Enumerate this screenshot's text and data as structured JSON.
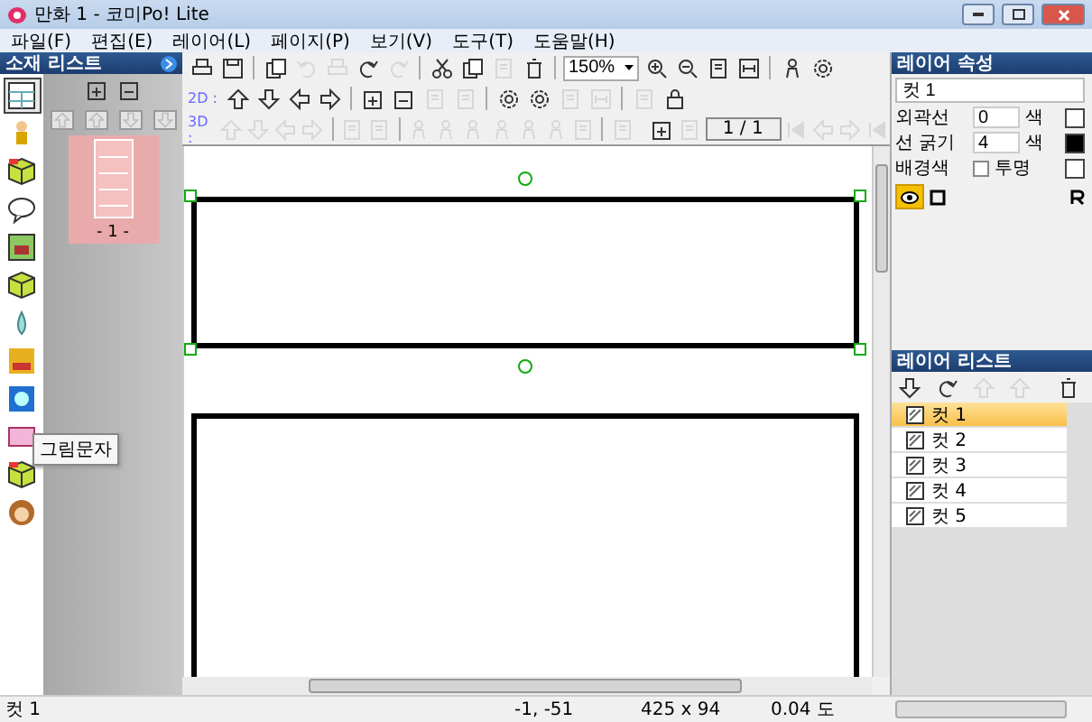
{
  "window": {
    "title": "만화 1 - 코미Po! Lite"
  },
  "menu": [
    "파일(F)",
    "편집(E)",
    "레이어(L)",
    "페이지(P)",
    "보기(V)",
    "도구(T)",
    "도움말(H)"
  ],
  "material_list": {
    "title": "소재 리스트",
    "tools": [
      {
        "kind": "frame",
        "selected": true
      },
      {
        "kind": "person",
        "selected": false
      },
      {
        "kind": "cube3d",
        "selected": false
      },
      {
        "kind": "bubble",
        "selected": false
      },
      {
        "kind": "picture",
        "selected": false
      },
      {
        "kind": "cube",
        "selected": false
      },
      {
        "kind": "drop",
        "selected": false
      },
      {
        "kind": "glyph",
        "selected": false
      },
      {
        "kind": "burst",
        "selected": false
      },
      {
        "kind": "card",
        "selected": false
      },
      {
        "kind": "cube3d",
        "selected": false
      },
      {
        "kind": "face",
        "selected": false
      }
    ],
    "tooltip": "그림문자",
    "pages": [
      {
        "label": "- 1 -",
        "selected": true
      }
    ]
  },
  "toolbar": {
    "zoom": "150%",
    "label_2d": "2D :",
    "label_3d": "3D :",
    "page": "1 / 1",
    "row_1": [
      {
        "kind": "printer",
        "disabled": false
      },
      {
        "kind": "disk",
        "disabled": false
      },
      {
        "kind": "sep"
      },
      {
        "kind": "docs",
        "disabled": false
      },
      {
        "kind": "undo",
        "disabled": true
      },
      {
        "kind": "printer",
        "disabled": true
      },
      {
        "kind": "redo",
        "disabled": false
      },
      {
        "kind": "redo",
        "disabled": true
      },
      {
        "kind": "sep"
      },
      {
        "kind": "scissors",
        "disabled": false
      },
      {
        "kind": "docs",
        "disabled": false
      },
      {
        "kind": "page",
        "disabled": true
      },
      {
        "kind": "trash",
        "disabled": false
      }
    ],
    "row_1b": [
      {
        "kind": "zoom_in",
        "disabled": false
      },
      {
        "kind": "zoom_out",
        "disabled": false
      },
      {
        "kind": "page",
        "disabled": false
      },
      {
        "kind": "fit",
        "disabled": false
      },
      {
        "kind": "sep"
      },
      {
        "kind": "person",
        "disabled": false
      },
      {
        "kind": "gear",
        "disabled": false
      }
    ],
    "row_2": [
      {
        "kind": "up",
        "disabled": false
      },
      {
        "kind": "down",
        "disabled": false
      },
      {
        "kind": "left",
        "disabled": false
      },
      {
        "kind": "right",
        "disabled": false
      },
      {
        "kind": "sep"
      },
      {
        "kind": "plus",
        "disabled": false
      },
      {
        "kind": "minus",
        "disabled": false
      },
      {
        "kind": "page",
        "disabled": true
      },
      {
        "kind": "page",
        "disabled": true
      },
      {
        "kind": "sep"
      },
      {
        "kind": "gear",
        "disabled": false
      },
      {
        "kind": "gear",
        "disabled": false
      },
      {
        "kind": "page",
        "disabled": true
      },
      {
        "kind": "fit",
        "disabled": true
      },
      {
        "kind": "sep"
      },
      {
        "kind": "page",
        "disabled": true
      },
      {
        "kind": "lock",
        "disabled": false
      }
    ],
    "row_3": [
      {
        "kind": "up",
        "disabled": true
      },
      {
        "kind": "down",
        "disabled": true
      },
      {
        "kind": "left",
        "disabled": true
      },
      {
        "kind": "right",
        "disabled": true
      },
      {
        "kind": "sep"
      },
      {
        "kind": "page",
        "disabled": true
      },
      {
        "kind": "page",
        "disabled": true
      },
      {
        "kind": "sep"
      },
      {
        "kind": "person",
        "disabled": true
      },
      {
        "kind": "person",
        "disabled": true
      },
      {
        "kind": "person",
        "disabled": true
      },
      {
        "kind": "person",
        "disabled": true
      },
      {
        "kind": "person",
        "disabled": true
      },
      {
        "kind": "person",
        "disabled": true
      },
      {
        "kind": "page",
        "disabled": true
      },
      {
        "kind": "sep"
      },
      {
        "kind": "page",
        "disabled": true
      }
    ],
    "row_3b": [
      {
        "kind": "plus",
        "disabled": false
      },
      {
        "kind": "page",
        "disabled": true
      }
    ],
    "row_3c": [
      {
        "kind": "first",
        "disabled": true
      },
      {
        "kind": "left",
        "disabled": true
      },
      {
        "kind": "right",
        "disabled": true
      },
      {
        "kind": "last",
        "disabled": true
      }
    ]
  },
  "canvas": {
    "panels": [
      {
        "selected": true
      },
      {
        "selected": false
      }
    ]
  },
  "layer_props": {
    "title": "레이어 속성",
    "name": "컷 1",
    "outline": {
      "label": "외곽선",
      "value": "0",
      "color_label": "색",
      "color": "#ffffff"
    },
    "width": {
      "label": "선 굵기",
      "value": "4",
      "color_label": "색",
      "color": "#000000"
    },
    "background": {
      "label": "배경색",
      "checkbox": "투명",
      "checked": false,
      "color": "#ffffff"
    },
    "view": {
      "eye_on": true
    }
  },
  "layer_list": {
    "title": "레이어 리스트",
    "tools": [
      {
        "kind": "down",
        "disabled": false
      },
      {
        "kind": "redo",
        "disabled": false
      },
      {
        "kind": "up",
        "disabled": true
      },
      {
        "kind": "up",
        "disabled": true
      },
      {
        "kind": "sep"
      },
      {
        "kind": "trash",
        "disabled": false
      }
    ],
    "items": [
      {
        "label": "컷 1",
        "selected": true
      },
      {
        "label": "컷 2",
        "selected": false
      },
      {
        "label": "컷 3",
        "selected": false
      },
      {
        "label": "컷 4",
        "selected": false
      },
      {
        "label": "컷 5",
        "selected": false
      }
    ]
  },
  "status_bar": {
    "layer": "컷 1",
    "position": "-1, -51",
    "size": "425 x 94",
    "angle": "0.04 도"
  }
}
